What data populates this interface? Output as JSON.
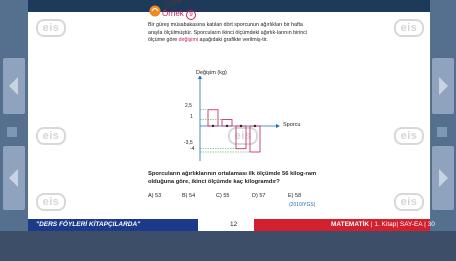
{
  "watermark": {
    "text": "eis"
  },
  "question": {
    "osym_label": "ÖSYM",
    "example_label": "Örnek",
    "example_number": "9",
    "text_before": "Bir güreş müsabakasına katılan dört sporcunun ağırlıkları bir hafta arayla ölçülmüştür. Sporcuların ikinci ölçümdeki ağırlık-larının birinci ölçüme göre ",
    "text_highlight": "değişimi",
    "text_after": " aşağıdaki grafikte verilmiş-tir.",
    "question_text": "Sporcuların ağırlıklarının ortalaması ilk ölçümde 56 kilog-ram olduğuna göre, ikinci ölçümde kaç kilogramdır?",
    "options": [
      "A) 53",
      "B) 54",
      "C) 55",
      "D) 57",
      "E) 58"
    ],
    "source": "(2010/YGS)"
  },
  "chart_data": {
    "type": "bar",
    "ylabel": "Değişim (kg)",
    "xlabel": "Sporcu",
    "y_ticks": [
      "2,5",
      "1",
      "-3,5",
      "-4"
    ],
    "values": [
      2.5,
      1,
      -3.5,
      -4
    ]
  },
  "footer": {
    "left_text": "\"DERS FÖYLERİ KİTAPÇILARDA\"",
    "page_number": "12",
    "subject": "MATEMATİK",
    "book_info": " | 1. Kitap| SAY-EA | 30"
  }
}
